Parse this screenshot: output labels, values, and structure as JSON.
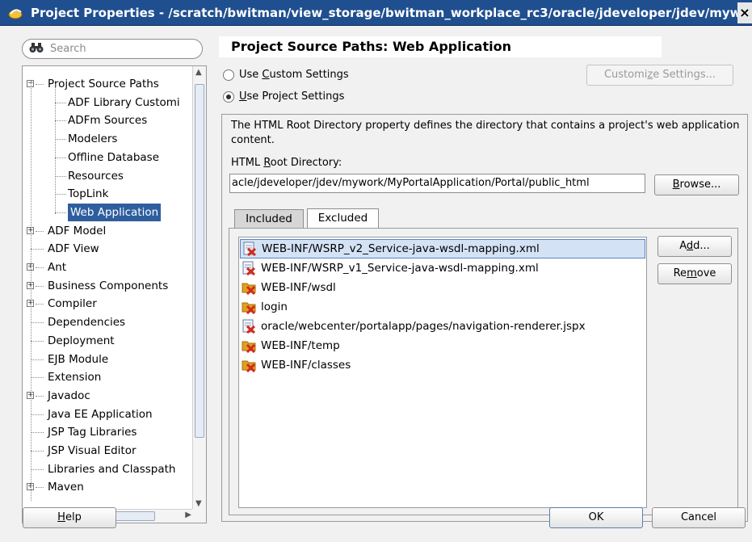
{
  "window": {
    "title": "Project Properties - /scratch/bwitman/view_storage/bwitman_workplace_rc3/oracle/jdeveloper/jdev/myw",
    "close": "×"
  },
  "search": {
    "placeholder": "Search"
  },
  "tree": {
    "items": [
      {
        "label": "Project Source Paths",
        "expander": "−"
      },
      {
        "label": "ADF Library Customi"
      },
      {
        "label": "ADFm Sources"
      },
      {
        "label": "Modelers"
      },
      {
        "label": "Offline Database"
      },
      {
        "label": "Resources"
      },
      {
        "label": "TopLink"
      },
      {
        "label": "Web Application",
        "selected": true
      },
      {
        "label": "ADF Model",
        "expander": "+"
      },
      {
        "label": "ADF View"
      },
      {
        "label": "Ant",
        "expander": "+"
      },
      {
        "label": "Business Components",
        "expander": "+"
      },
      {
        "label": "Compiler",
        "expander": "+"
      },
      {
        "label": "Dependencies"
      },
      {
        "label": "Deployment"
      },
      {
        "label": "EJB Module"
      },
      {
        "label": "Extension"
      },
      {
        "label": "Javadoc",
        "expander": "+"
      },
      {
        "label": "Java EE Application"
      },
      {
        "label": "JSP Tag Libraries"
      },
      {
        "label": "JSP Visual Editor"
      },
      {
        "label": "Libraries and Classpath"
      },
      {
        "label": "Maven",
        "expander": "+"
      }
    ]
  },
  "main": {
    "heading": "Project Source Paths: Web Application",
    "use_custom_settings": {
      "pre": "Use ",
      "u": "C",
      "post": "ustom Settings"
    },
    "use_project_settings": {
      "pre": "",
      "u": "U",
      "post": "se Project Settings"
    },
    "customize_button": {
      "pre": "Customi",
      "u": "z",
      "post": "e Settings..."
    },
    "description": "The HTML Root Directory property defines the directory that contains a project's web application content.",
    "html_root_label": {
      "pre": "HTML ",
      "u": "R",
      "post": "oot Directory:"
    },
    "html_root_value": "acle/jdeveloper/jdev/mywork/MyPortalApplication/Portal/public_html",
    "browse_button": {
      "pre": "",
      "u": "B",
      "post": "rowse..."
    },
    "tabs": [
      "Included",
      "Excluded"
    ],
    "excluded": [
      {
        "name": "WEB-INF/WSRP_v2_Service-java-wsdl-mapping.xml",
        "icon": "file-excluded-icon",
        "selected": true
      },
      {
        "name": "WEB-INF/WSRP_v1_Service-java-wsdl-mapping.xml",
        "icon": "file-excluded-icon"
      },
      {
        "name": "WEB-INF/wsdl",
        "icon": "folder-excluded-icon"
      },
      {
        "name": "login",
        "icon": "folder-excluded-icon"
      },
      {
        "name": "oracle/webcenter/portalapp/pages/navigation-renderer.jspx",
        "icon": "file-excluded-icon"
      },
      {
        "name": "WEB-INF/temp",
        "icon": "folder-excluded-icon"
      },
      {
        "name": "WEB-INF/classes",
        "icon": "folder-excluded-icon"
      }
    ],
    "add_button": {
      "pre": "A",
      "u": "d",
      "post": "d..."
    },
    "remove_button": {
      "pre": "Re",
      "u": "m",
      "post": "ove"
    }
  },
  "footer": {
    "help": {
      "pre": "",
      "u": "H",
      "post": "elp"
    },
    "ok": "OK",
    "cancel": "Cancel"
  },
  "colors": {
    "titlebar": "#1f4f8f",
    "selection": "#2e5e9e",
    "excluded_mark": "#d22a1e",
    "folder": "#e0a020"
  }
}
